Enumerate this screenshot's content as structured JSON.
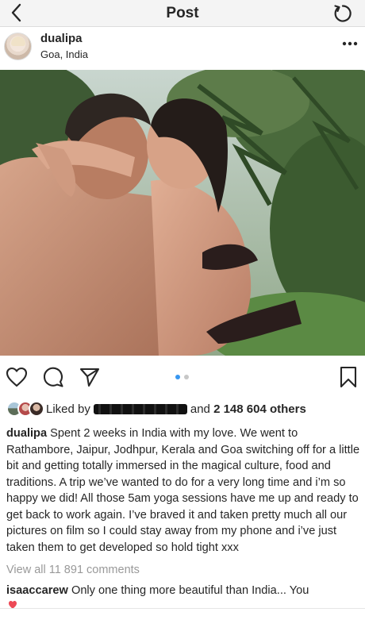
{
  "topbar": {
    "title": "Post",
    "back_icon": "chevron-left-icon",
    "refresh_icon": "refresh-icon"
  },
  "post": {
    "username": "dualipa",
    "location": "Goa, India",
    "more_icon": "more-horizontal-icon",
    "carousel": {
      "total": 2,
      "active_index": 1
    },
    "likes": {
      "prefix": "Liked by",
      "connector": "and",
      "count": "2 148 604 others"
    },
    "caption": "Spent 2 weeks in India with my love. We went to Rathambore, Jaipur, Jodhpur, Kerala and Goa switching off for a little bit and getting totally immersed in the magical culture, food and traditions. A trip we’ve wanted to do for a very long time and i’m so happy we did! All those 5am yoga sessions have me up and ready to get back to work again. I’ve braved it and taken pretty much all our pictures on film so I could stay away from my phone and i’ve just taken them to get developed so hold tight xxx",
    "view_all_comments": "View all 11 891 comments",
    "top_comment": {
      "username": "isaaccarew",
      "text": "Only one thing more beautiful than India... You"
    }
  },
  "icons": {
    "like": "heart-icon",
    "comment": "comment-icon",
    "share": "send-icon",
    "save": "bookmark-icon"
  },
  "colors": {
    "accent": "#3897f0",
    "text": "#262626",
    "muted": "#999999",
    "topbar_bg": "#f4f4f4"
  }
}
